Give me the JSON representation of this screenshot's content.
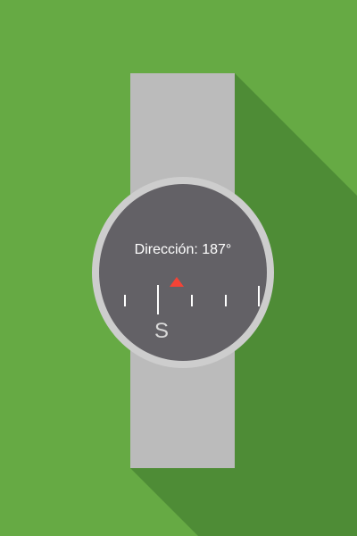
{
  "compass": {
    "direction_label": "Dirección: 187°",
    "heading_degrees": 187,
    "cardinal_label": "S",
    "marker_color": "#f44336"
  },
  "colors": {
    "background": "#66aa44",
    "long_shadow": "#4e8c36",
    "strap": "#bbbbbb",
    "bezel": "#cdcdcd",
    "face": "#636166",
    "text": "#ffffff"
  }
}
